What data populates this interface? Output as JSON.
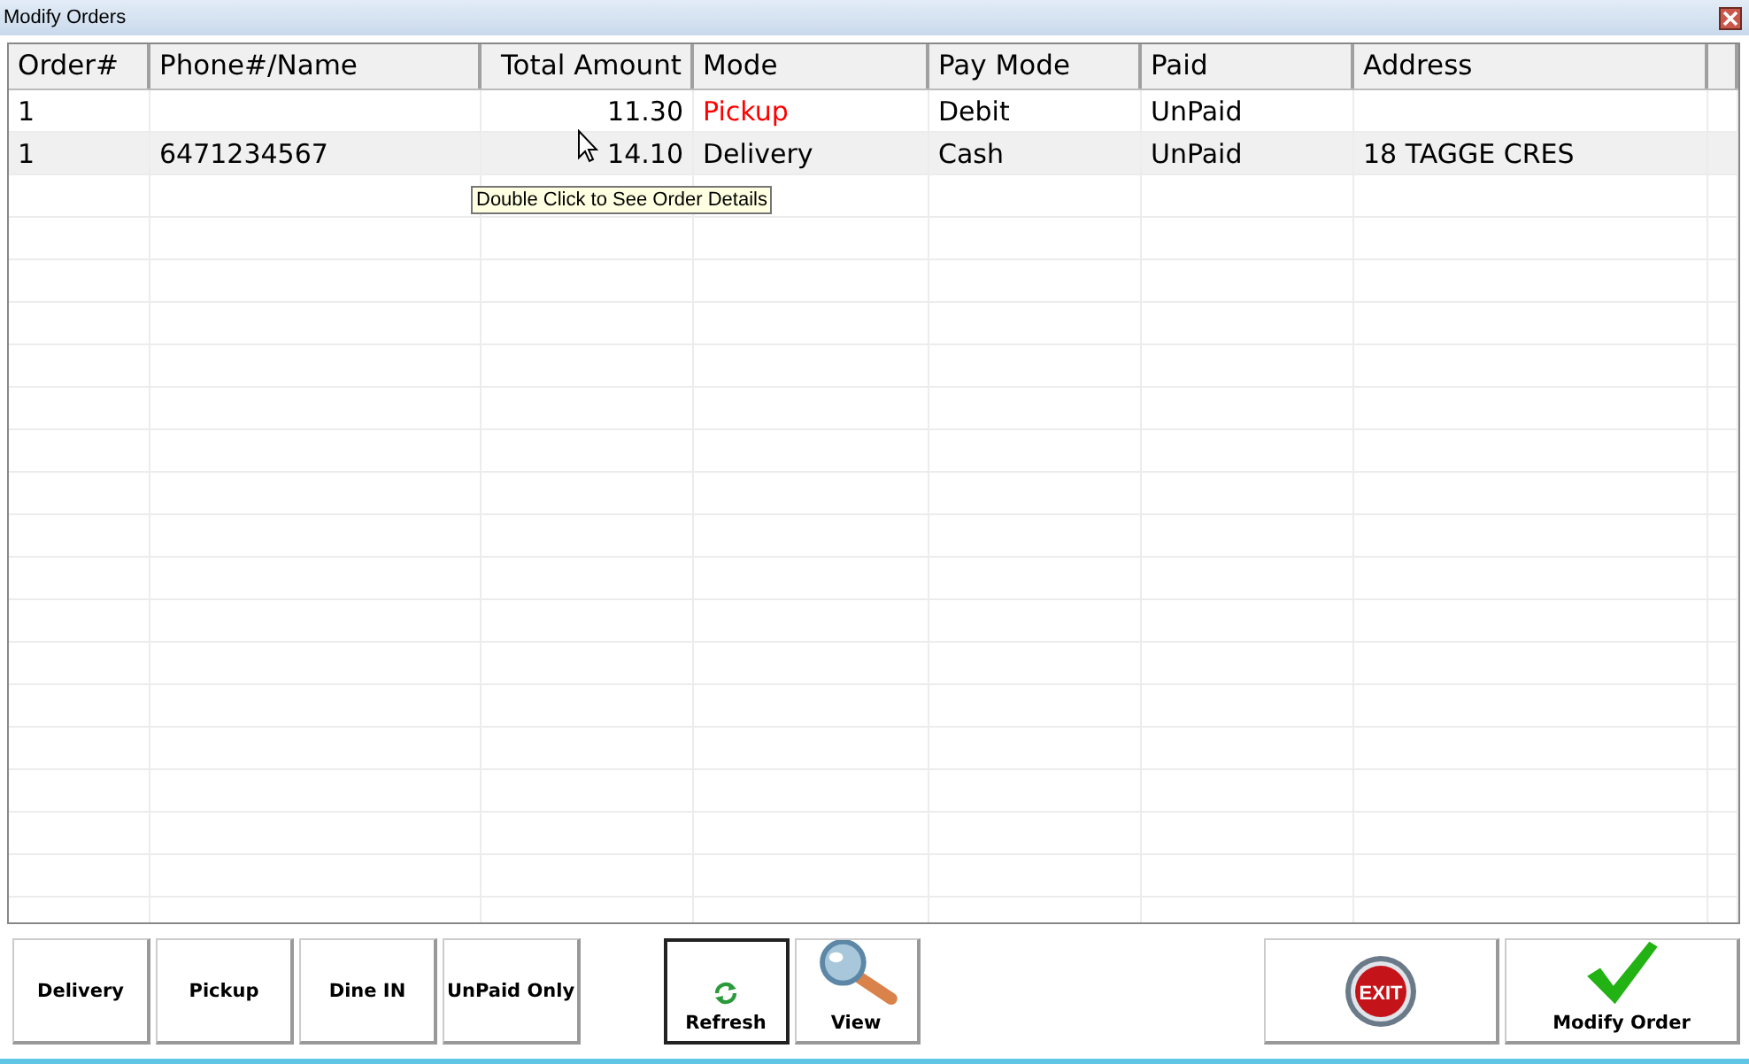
{
  "window": {
    "title": "Modify Orders"
  },
  "table": {
    "columns": [
      "Order#",
      "Phone#/Name",
      "Total Amount",
      "Mode",
      "Pay Mode",
      "Paid",
      "Address"
    ],
    "rows": [
      {
        "cells": [
          "1",
          "",
          "11.30",
          "Pickup",
          "Debit",
          "UnPaid",
          ""
        ],
        "color": "#ff0000",
        "selected": false
      },
      {
        "cells": [
          "1",
          "6471234567",
          "14.10",
          "Delivery",
          "Cash",
          "UnPaid",
          "18 TAGGE CRES"
        ],
        "color": "#000000",
        "selected": true
      }
    ]
  },
  "tooltip": "Double Click to See Order Details",
  "filter_buttons": [
    {
      "label": "Delivery"
    },
    {
      "label": "Pickup"
    },
    {
      "label": "Dine IN"
    },
    {
      "label": "UnPaid Only"
    }
  ],
  "action_buttons": [
    {
      "kind": "refresh",
      "label": "Refresh",
      "focused": true
    },
    {
      "kind": "view",
      "label": "View",
      "focused": false
    }
  ],
  "exit_button": {
    "icon_text": "EXIT"
  },
  "modify_button": {
    "label": "Modify Order"
  }
}
